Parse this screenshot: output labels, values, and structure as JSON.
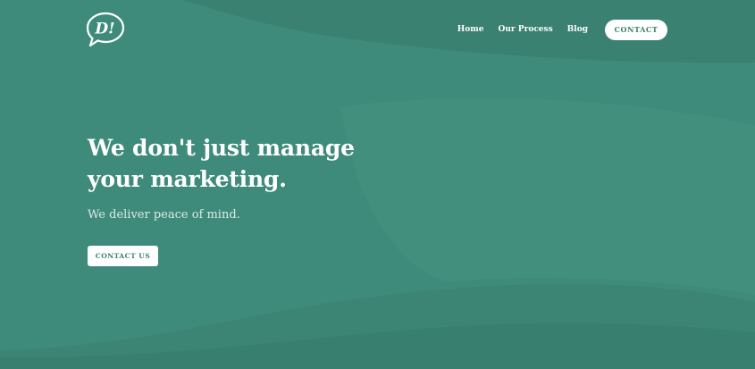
{
  "nav": {
    "items": [
      {
        "label": "Home"
      },
      {
        "label": "Our Process"
      },
      {
        "label": "Blog"
      }
    ],
    "contact_label": "CONTACT"
  },
  "hero": {
    "title_line1": "We don't just manage",
    "title_line2": "your marketing.",
    "subtitle": "We deliver peace of mind.",
    "cta_label": "CONTACT US"
  },
  "logo": {
    "text": "D!",
    "icon": "speech-bubble-logo-icon"
  },
  "colors": {
    "background": "#3e8a7a",
    "wave_light": "#489a88",
    "wave_dark": "#367d6e",
    "button_bg": "#ffffff",
    "button_text": "#3b7f70"
  }
}
